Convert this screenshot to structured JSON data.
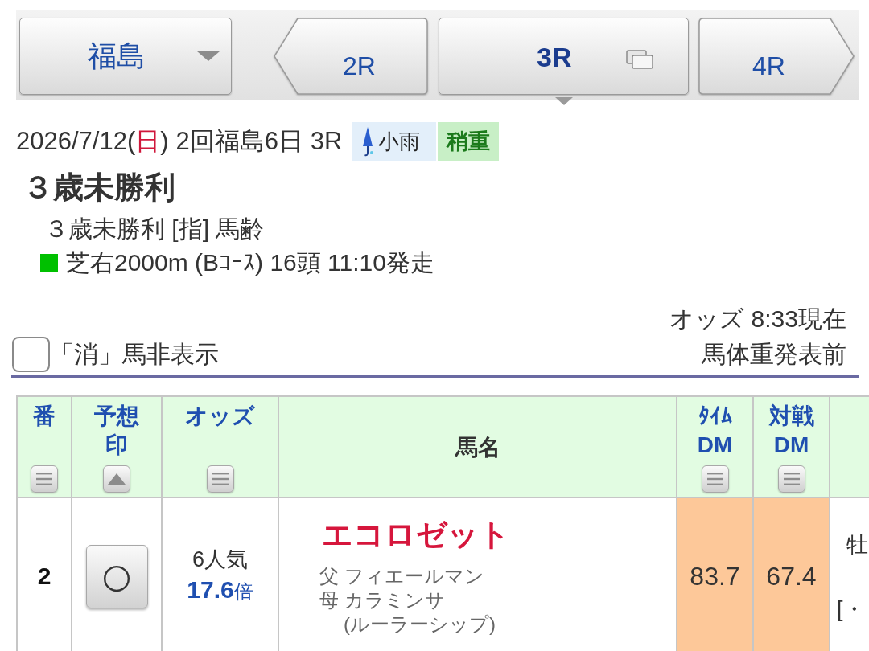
{
  "race_nav": {
    "venue": {
      "label": "福島"
    },
    "races": [
      {
        "label": "2R",
        "kind": "prev",
        "selected": false
      },
      {
        "label": "3R",
        "kind": "current",
        "selected": true
      },
      {
        "label": "4R",
        "kind": "next",
        "selected": false
      }
    ]
  },
  "race_info": {
    "date_parts": [
      {
        "text": "2026/7/12(",
        "kind": "plain"
      },
      {
        "text": "日",
        "kind": "sunday"
      },
      {
        "text": ")",
        "kind": "plain"
      }
    ],
    "meeting": "2回福島6日 3R",
    "weather": "小雨",
    "going": "稍重",
    "title": "３歳未勝利",
    "conditions": "３歳未勝利 [指] 馬齢",
    "course": {
      "kind": "turf",
      "text": "芝右2000m (Bｺｰｽ) 16頭 11:10発走"
    }
  },
  "options": {
    "hide_scratched": {
      "label": "「消」馬非表示",
      "checked": false
    },
    "odds_time": "オッズ 8:33現在",
    "weight_status": "馬体重発表前"
  },
  "table": {
    "columns": [
      {
        "label": "番",
        "kind": "menu"
      },
      {
        "label": "予想印",
        "kind": "ascending"
      },
      {
        "label": "オッズ",
        "kind": "menu"
      },
      {
        "label": "馬名",
        "kind": "plain"
      },
      {
        "label": "ﾀｲﾑDM",
        "kind": "menu"
      },
      {
        "label": "対戦DM",
        "kind": "menu"
      }
    ],
    "rows": [
      {
        "number": "2",
        "mark": "○",
        "popularity": "6人気",
        "odds": "17.6",
        "odds_unit": "倍",
        "name": "エコロゼット",
        "sire": "父 フィエールマン",
        "dam": "母 カラミンサ",
        "broodmare_sire": "(ルーラーシップ)",
        "time_dm": {
          "value": "83.7",
          "highlight": true
        },
        "match_dm": {
          "value": "67.4",
          "highlight": true
        },
        "column_7": [
          "牡",
          "[・"
        ]
      }
    ]
  }
}
